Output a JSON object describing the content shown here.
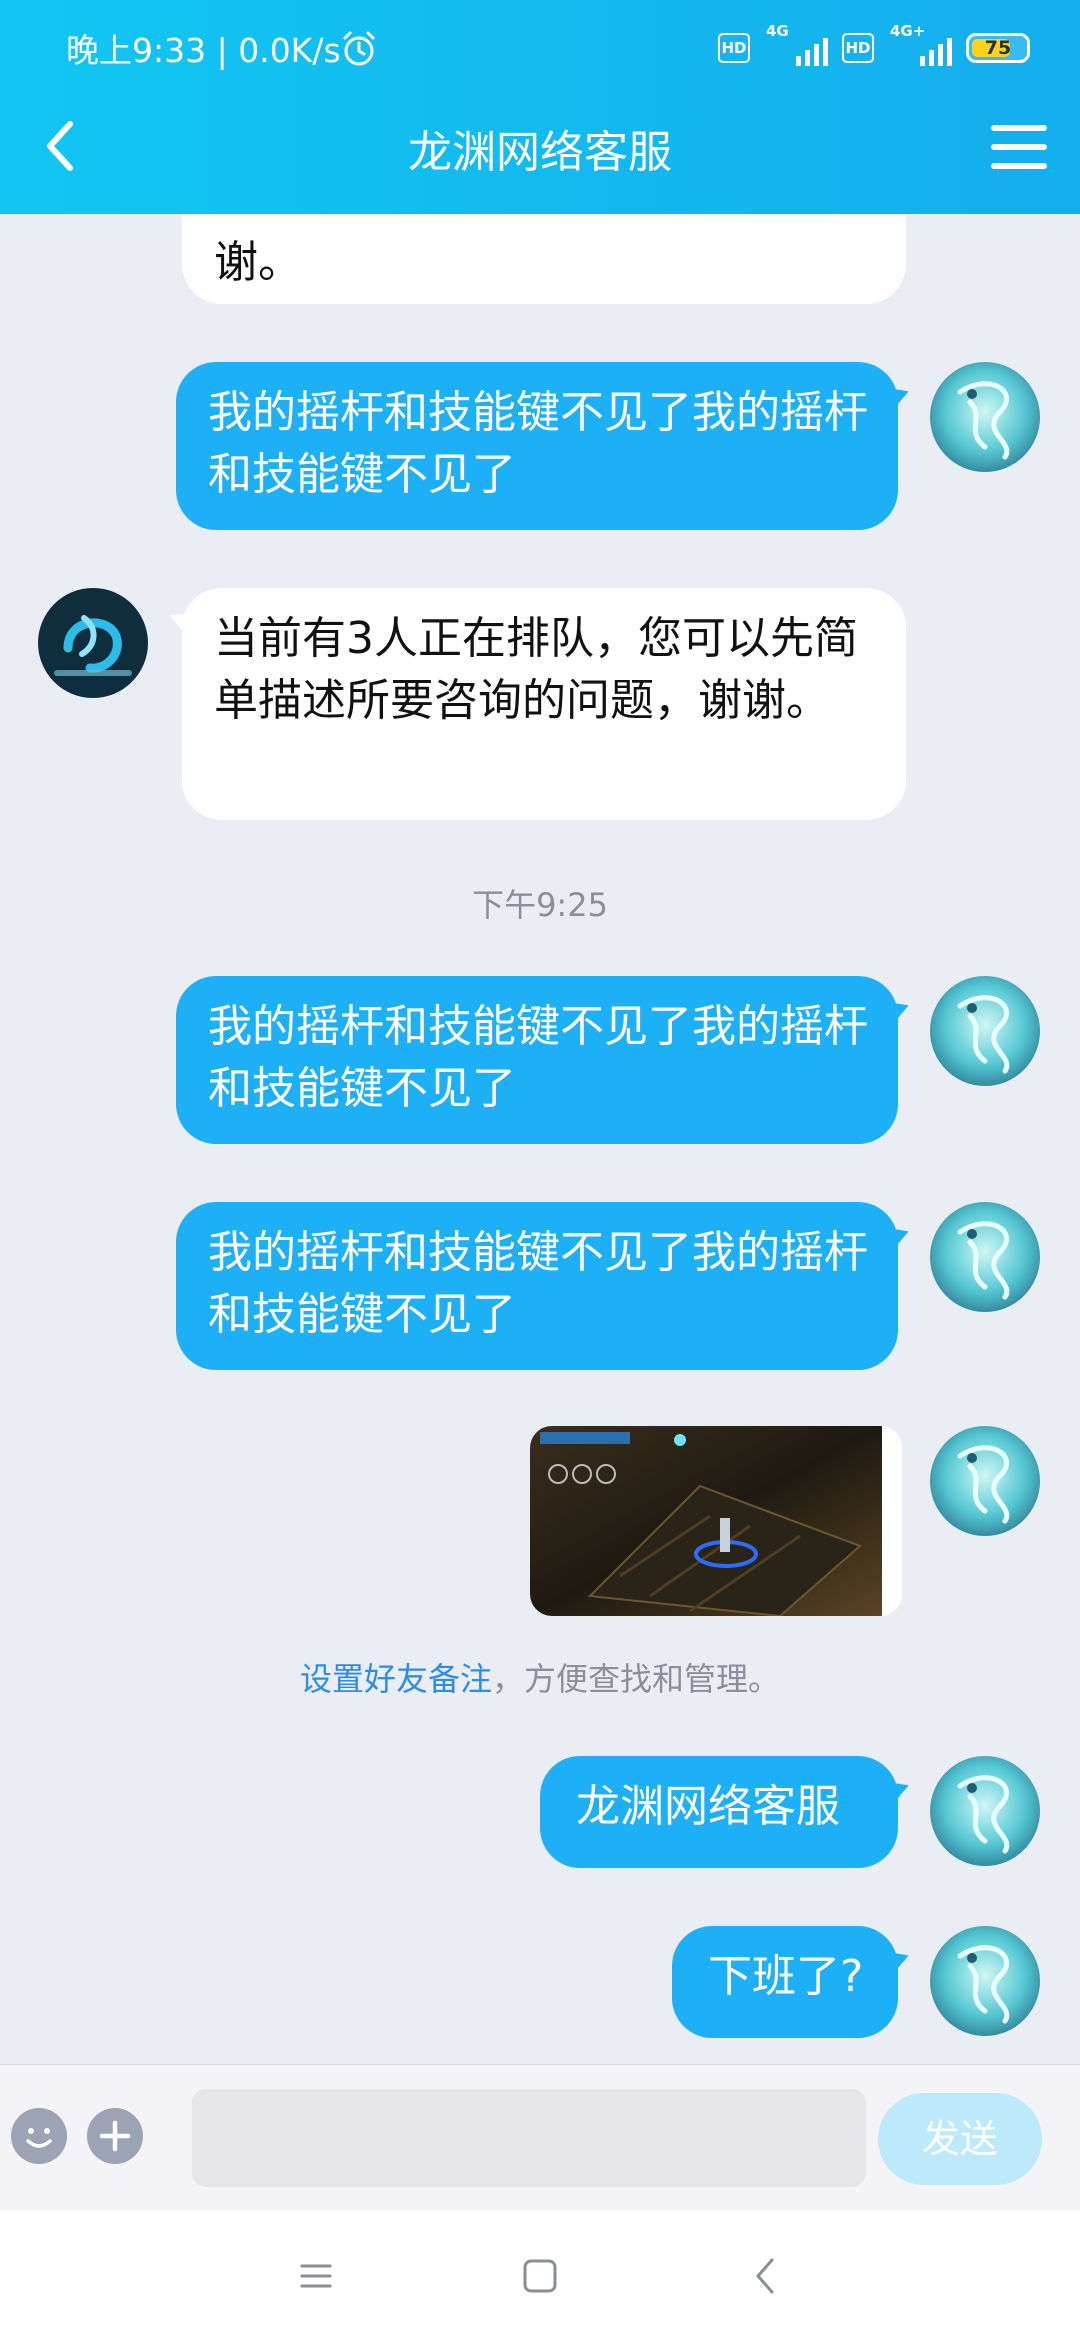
{
  "status_bar": {
    "time_speed": "晚上9:33 | 0.0K/s",
    "sim1_badge": "HD",
    "sim1_network": "4G",
    "sim2_badge": "HD",
    "sim2_network": "4G+",
    "battery_level": "75",
    "battery_fraction": 0.75
  },
  "header": {
    "title": "龙渊网络客服"
  },
  "messages": [
    {
      "side": "in",
      "text": "谢。"
    },
    {
      "side": "out",
      "text": "我的摇杆和技能键不见了我的摇杆和技能键不见了"
    },
    {
      "side": "in",
      "text": "当前有3人正在排队，您可以先简单描述所要咨询的问题，谢谢。"
    },
    {
      "side": "time",
      "text": "下午9:25"
    },
    {
      "side": "out",
      "text": "我的摇杆和技能键不见了我的摇杆和技能键不见了"
    },
    {
      "side": "out",
      "text": "我的摇杆和技能键不见了我的摇杆和技能键不见了"
    },
    {
      "side": "out_image",
      "text": ""
    },
    {
      "side": "tip",
      "link": "设置好友备注",
      "text": "，方便查找和管理。"
    },
    {
      "side": "out",
      "text": "龙渊网络客服"
    },
    {
      "side": "out",
      "text": "下班了?"
    }
  ],
  "input_bar": {
    "placeholder": "",
    "send_label": "发送"
  },
  "icons": {
    "back": "chevron-left-icon",
    "menu": "menu-icon",
    "emoji": "smiley-icon",
    "plus": "plus-icon",
    "nav_recents": "recents-icon",
    "nav_home": "home-icon",
    "nav_back": "back-icon"
  },
  "colors": {
    "header_bg": "#14B9F0",
    "outgoing_bubble": "#1DB0F6",
    "incoming_bubble": "#FFFFFF",
    "chat_bg": "#EBEDF5",
    "link": "#2D8CE6",
    "send_button": "#BCEAFA"
  }
}
